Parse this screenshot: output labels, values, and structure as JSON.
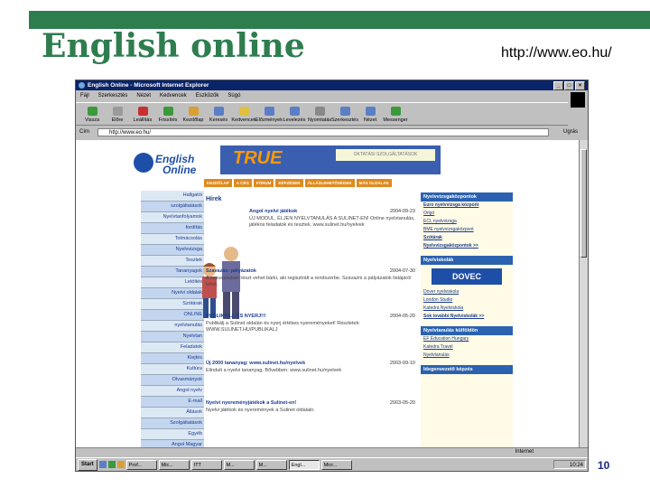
{
  "slide": {
    "title": "English online",
    "url": "http://www.eo.hu/",
    "page_number": "10"
  },
  "browser": {
    "title": "EngIish Online - Microsoft Internet Explorer",
    "menu": [
      "Fájl",
      "Szerkesztés",
      "Nézet",
      "Kedvencek",
      "Eszközök",
      "Súgó"
    ],
    "toolbar": [
      "Vissza",
      "Előre",
      "Leállítás",
      "Frissítés",
      "Kezdőlap",
      "Keresés",
      "Kedvencek",
      "Előzmények",
      "Levelezés",
      "Nyomtatás",
      "Szerkesztés",
      "Nézet",
      "Messenger"
    ],
    "address_label": "Cím",
    "address_value": "http://www.eo.hu/",
    "go_label": "Ugrás",
    "status_zone": "Internet"
  },
  "site": {
    "logo_line1": "English",
    "logo_line2": "Online",
    "banner_text": "TRUE",
    "banner_sub": "OKTATÁSI SZOLGÁLTATÁSOK",
    "nav": [
      "KEZDŐLAP",
      "A CÉG",
      "FÓRUM",
      "KÉPZÉSEK",
      "ÁLLÁSLEHETŐSÉGEK",
      "MÁS OLDALAK"
    ],
    "left_menu": [
      "Hallgatói",
      "szolgáltatások",
      "Nyelvtanfolyamok",
      "fordítás",
      "Tolmácsolás",
      "Nyelvvizsga",
      "Tesztek",
      "Tananyagok",
      "Letöltés",
      "Nyelvi oldalak",
      "Szótárak",
      "ONLINE",
      "nyelvtanulás",
      "Nyelvtan",
      "Feladatok",
      "Kiejtés",
      "Kultúra",
      "Olvasmányok",
      "Angol nyelv",
      "E-mail",
      "Állások",
      "Szolgáltatások",
      "Egyéb",
      "Angol Magyar"
    ],
    "hirek_label": "Hírek",
    "news": [
      {
        "title": "Angol nyelvi játékok",
        "date": "2004-09-23",
        "body": "ÚJ MODUL, ÉLJEN NYELVTANULÁS A SULINET-EN! Online nyelvtanulás, játékos feladatok és tesztek. www.sulinet.hu/nyelvek"
      },
      {
        "title": "Szavazás: pályázatok",
        "date": "2004-07-30",
        "body": "A szavazásban részt vehet bárki, aki regisztrált a rendszerbe. Szavazni a pályázatok listájáról lehet."
      },
      {
        "title": "PUBLIKÁLJ, ÉS NYERJ!!!",
        "date": "2004-05-20",
        "body": "Publikálj a Sulinet oldalán és nyerj értékes nyereményeket! Részletek: WWW.SULINET.HU/PUBLIKALJ"
      },
      {
        "title": "Új 2000 tananyag: www.sulinet.hu/nyelvek",
        "date": "2003-09-10",
        "body": "Elindult a nyelvi tananyag. Bővebben: www.sulinet.hu/nyelvek"
      },
      {
        "title": "Nyelvi nyereményjátékok a Sulinet-en!",
        "date": "2003-05-20",
        "body": "Nyelvi játékok és nyeremények a Sulinet oldalain."
      }
    ],
    "right_boxes": [
      {
        "header": "Nyelvvizsgaközpontok",
        "items": [
          "Euro nyelvvizsga központ",
          "Origó",
          "ECL nyelvvizsga",
          "BME nyelvvizsgaközpont",
          "Szótárak",
          "Nyelvvizsgaközpontok >>"
        ]
      },
      {
        "header": "Nyelviskolák",
        "items": [
          "DOVEC",
          "Dover nyelviskola",
          "London Studio",
          "Katedra Nyelviskola",
          "Sok további Nyelviskolák >>"
        ]
      },
      {
        "header": "Nyelvtanulás külföldön",
        "items": [
          "EF Education Hungary",
          "Katedra Travel",
          "Nyelvtanulás",
          "Idegenvezető képzés"
        ]
      }
    ]
  },
  "taskbar": {
    "start": "Start",
    "tasks": [
      "Prof...",
      "Mic...",
      "ITT",
      "M...",
      "M...",
      "Engl...",
      "Micr..."
    ],
    "clock": "10:24"
  }
}
